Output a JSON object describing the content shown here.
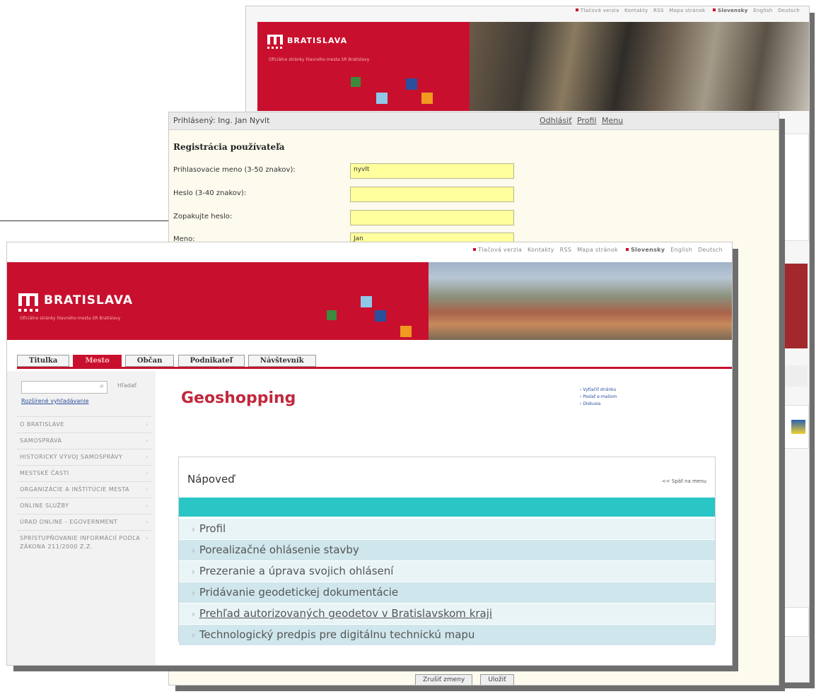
{
  "top_links": {
    "print": "Tlačová verzia",
    "contacts": "Kontakty",
    "rss": "RSS",
    "sitemap": "Mapa stránok",
    "lang_sk": "Slovensky",
    "lang_en": "English",
    "lang_de": "Deutsch"
  },
  "brand": {
    "name": "BRATISLAVA",
    "tagline": "Oficiálne stránky hlavného mesta SR Bratislavy"
  },
  "registration": {
    "logged_in": "Prihlásený: Ing. Jan Nyvlt",
    "logout": "Odhlásiť",
    "profile": "Profil",
    "menu": "Menu",
    "title": "Registrácia používateľa",
    "fields": [
      {
        "label": "Prihlasovacie meno (3-50 znakov):",
        "value": "nyvlt"
      },
      {
        "label": "Heslo (3-40 znakov):",
        "value": ""
      },
      {
        "label": "Zopakujte heslo:",
        "value": ""
      },
      {
        "label": "Meno:",
        "value": "Jan"
      }
    ],
    "button_cancel": "Zrušiť zmeny",
    "button_save": "Uložiť"
  },
  "tabs": [
    "Titulka",
    "Mesto",
    "Občan",
    "Podnikateľ",
    "Návštevník"
  ],
  "active_tab": "Mesto",
  "sidebar": {
    "search_button": "Hľadať",
    "advanced_search": "Rozšírené vyhľadávanie",
    "menu": [
      "O BRATISLAVE",
      "SAMOSPRÁVA",
      "HISTORICKÝ VÝVOJ SAMOSPRÁVY",
      "MESTSKÉ ČASTI",
      "ORGANIZÁCIE A INŠTITÚCIE MESTA",
      "ONLINE SLUŽBY",
      "ÚRAD ONLINE - EGOVERNMENT",
      "SPRÍSTUPŇOVANIE INFORMÁCIÍ PODĽA ZÁKONA 211/2000 Z.Z."
    ]
  },
  "page": {
    "title": "Geoshopping",
    "side_links": [
      "Vytlačiť stránku",
      "Poslať e-mailom",
      "Diskusia"
    ]
  },
  "help_panel": {
    "title": "Nápoveď",
    "back": "<< Späť na menu",
    "items": [
      "Profil",
      "Porealizačné ohlásenie stavby",
      "Prezeranie a úprava svojich ohlásení",
      "Pridávanie geodetickej dokumentácie",
      "Prehľad autorizovaných geodetov v Bratislavskom kraji",
      "Technologický predpis pre digitálnu technickú mapu"
    ]
  },
  "colors": {
    "brand_red": "#c8102e",
    "teal_bar": "#2ac6c6",
    "input_yellow": "#ffff9e"
  }
}
